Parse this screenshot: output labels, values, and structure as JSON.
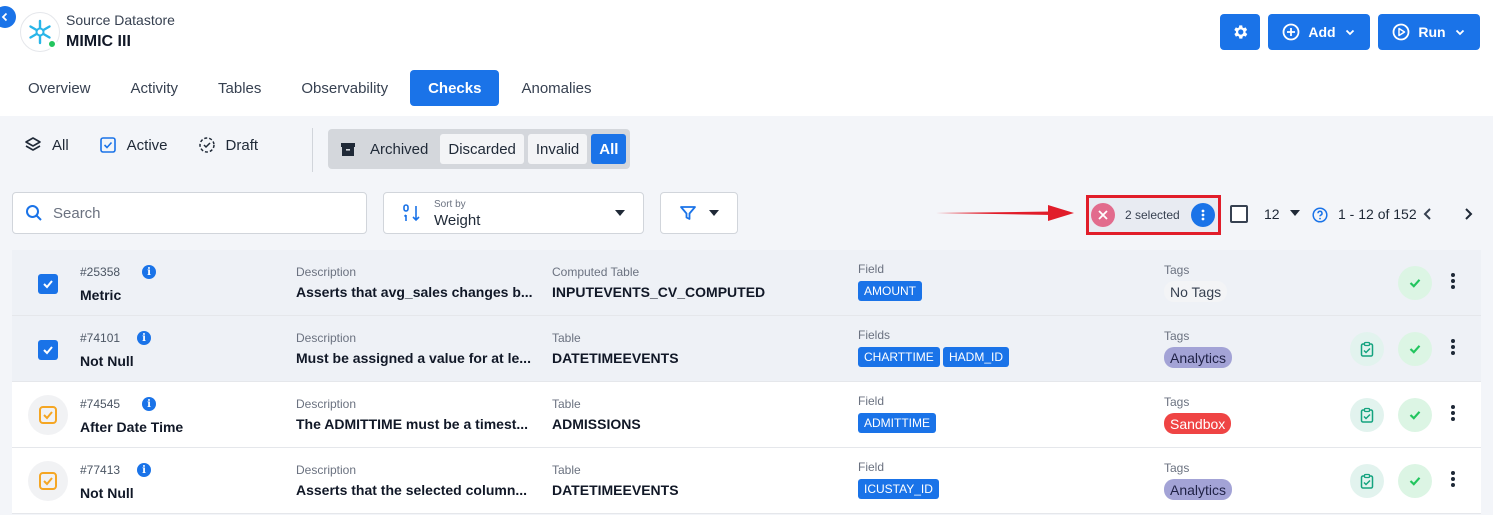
{
  "header": {
    "datastore_label": "Source Datastore",
    "datastore_name": "MIMIC III",
    "add_label": "Add",
    "run_label": "Run"
  },
  "tabs": [
    {
      "label": "Overview",
      "active": false
    },
    {
      "label": "Activity",
      "active": false
    },
    {
      "label": "Tables",
      "active": false
    },
    {
      "label": "Observability",
      "active": false
    },
    {
      "label": "Checks",
      "active": true
    },
    {
      "label": "Anomalies",
      "active": false
    }
  ],
  "status_filters": {
    "all": "All",
    "active": "Active",
    "draft": "Draft",
    "archived": "Archived",
    "discarded": "Discarded",
    "invalid": "Invalid",
    "archived_all": "All"
  },
  "toolbar": {
    "search_placeholder": "Search",
    "sort_caption": "Sort by",
    "sort_value": "Weight",
    "selected_text": "2 selected",
    "per_page": "12",
    "range": "1 - 12 of 152"
  },
  "rows": [
    {
      "id": "#25358",
      "name": "Metric",
      "selected": true,
      "desc_label": "Description",
      "desc": "Asserts that avg_sales changes b...",
      "table_label": "Computed Table",
      "table": "INPUTEVENTS_CV_COMPUTED",
      "field_label": "Field",
      "fields": [
        "AMOUNT"
      ],
      "tags_label": "Tags",
      "tag": "No Tags",
      "tag_kind": "none"
    },
    {
      "id": "#74101",
      "name": "Not Null",
      "selected": true,
      "desc_label": "Description",
      "desc": "Must be assigned a value for at le...",
      "table_label": "Table",
      "table": "DATETIMEEVENTS",
      "field_label": "Fields",
      "fields": [
        "CHARTTIME",
        "HADM_ID"
      ],
      "tags_label": "Tags",
      "tag": "Analytics",
      "tag_kind": "analytics"
    },
    {
      "id": "#74545",
      "name": "After Date Time",
      "selected": false,
      "desc_label": "Description",
      "desc": "The ADMITTIME must be a timest...",
      "table_label": "Table",
      "table": "ADMISSIONS",
      "field_label": "Field",
      "fields": [
        "ADMITTIME"
      ],
      "tags_label": "Tags",
      "tag": "Sandbox",
      "tag_kind": "sandbox"
    },
    {
      "id": "#77413",
      "name": "Not Null",
      "selected": false,
      "desc_label": "Description",
      "desc": "Asserts that the selected column...",
      "table_label": "Table",
      "table": "DATETIMEEVENTS",
      "field_label": "Field",
      "fields": [
        "ICUSTAY_ID"
      ],
      "tags_label": "Tags",
      "tag": "Analytics",
      "tag_kind": "analytics"
    }
  ],
  "colors": {
    "primary": "#1a73e8",
    "highlight_border": "#e11d2a",
    "success": "#22c55e",
    "draft_icon": "#f5a623"
  }
}
